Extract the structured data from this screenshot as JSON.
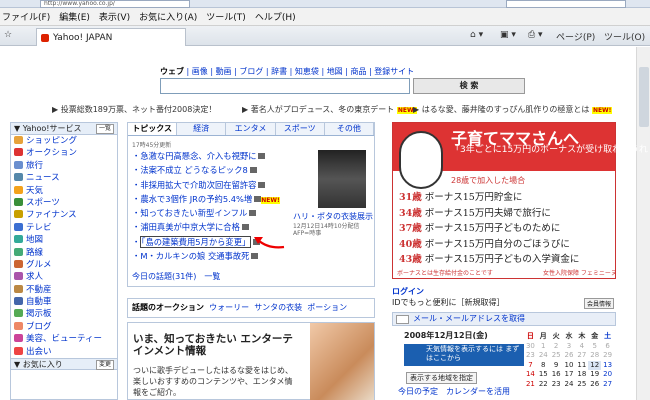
{
  "browser": {
    "url": "http://www.yahoo.co.jp/",
    "menu": [
      "ファイル(F)",
      "編集(E)",
      "表示(V)",
      "お気に入り(A)",
      "ツール(T)",
      "ヘルプ(H)"
    ],
    "tab_title": "Yahoo! JAPAN",
    "toolbar": [
      "ページ(P)",
      "ツール(O)"
    ]
  },
  "search": {
    "tabs": [
      "ウェブ",
      "画像",
      "動画",
      "ブログ",
      "辞書",
      "知恵袋",
      "地図",
      "商品",
      "登録サイト"
    ],
    "button": "検 索",
    "value": ""
  },
  "notices": [
    "投票総数189万票、ネット番付2008決定！",
    "著名人がプロデュース、冬の東京デート",
    "はるな愛、藤井隆のすっぴん肌作りの極意とは"
  ],
  "new_badge": "NEW!",
  "sidebar": {
    "header": "Yahoo!サービス",
    "header_button": "一覧",
    "items": [
      {
        "label": "ショッピング",
        "color": "#e7a23a"
      },
      {
        "label": "オークション",
        "color": "#d33"
      },
      {
        "label": "旅行",
        "color": "#6a8fcf"
      },
      {
        "label": "ニュース",
        "color": "#58a"
      },
      {
        "label": "天気",
        "color": "#f3a21c"
      },
      {
        "label": "スポーツ",
        "color": "#3a8f3a"
      },
      {
        "label": "ファイナンス",
        "color": "#c8a000"
      },
      {
        "label": "テレビ",
        "color": "#3b6fd2"
      },
      {
        "label": "地図",
        "color": "#3a9"
      },
      {
        "label": "路線",
        "color": "#4a7"
      },
      {
        "label": "グルメ",
        "color": "#c63"
      },
      {
        "label": "求人",
        "color": "#a5a"
      },
      {
        "label": "不動産",
        "color": "#b84"
      },
      {
        "label": "自動車",
        "color": "#46a"
      },
      {
        "label": "掲示板",
        "color": "#5a5"
      },
      {
        "label": "ブログ",
        "color": "#e86"
      },
      {
        "label": "美容、ビューティー",
        "color": "#c49"
      },
      {
        "label": "出会い",
        "color": "#e44"
      }
    ],
    "fav_header": "お気に入り",
    "fav_button": "変更"
  },
  "news": {
    "tabs": [
      "トピックス",
      "経済",
      "エンタメ",
      "スポーツ",
      "その他"
    ],
    "time": "17時45分更新",
    "items": [
      "急激な円高懸念、介入も視野に",
      "法案不成立 どうなるピック8",
      "非採用拡大で介助次回在留許容",
      "農水で3個作 JRの予約5.4%増",
      "知っておきたい新型インフル",
      "浦田真美が中京大学に合格",
      "「島の建築費用5月から変更」",
      "M・カルキンの娘 交通事故死"
    ],
    "photo_caption": "ハリ・ポタの衣装展示",
    "photo_credit": "12月12日14時10分配信 AFP=時事",
    "footer": "今日の話題(31件)　一覧"
  },
  "auction": {
    "label": "話題のオークション",
    "links": [
      "ウォーリー",
      "サンタの衣装",
      "ポーション"
    ]
  },
  "entertainment": {
    "title": "いま、知っておきたい エンターテインメント情報",
    "body": "ついに歌手デビューしたはるな愛をはじめ、楽しいおすすめのコンテンツや、エンタメ情報をご紹介。"
  },
  "ad": {
    "title": "子育てママさんへ",
    "subtitle": "「3年ごとに15万円のボーナスが受け取れてうれしい。」",
    "lead": "28歳で加入した場合",
    "rows": [
      {
        "age": "31歳",
        "text": "ボーナス15万円貯金に"
      },
      {
        "age": "34歳",
        "text": "ボーナス15万円夫婦で旅行に"
      },
      {
        "age": "37歳",
        "text": "ボーナス15万円子どものために"
      },
      {
        "age": "40歳",
        "text": "ボーナス15万円自分のごほうびに"
      },
      {
        "age": "43歳",
        "text": "ボーナス15万円子どもの入学資金に"
      }
    ],
    "footer": "ボーナスとは生存給付金のことです",
    "footer2": "女性入院保障 フェミニーヌ"
  },
  "login": {
    "title": "ログイン",
    "text": "IDでもっと便利に［新規取得］",
    "button": "会員情報"
  },
  "mail": {
    "label": "メール・メールアドレスを取得"
  },
  "calendar": {
    "date": "2008年12月12日(金)",
    "weather": "天気情報を表示するには まずはここから",
    "weather_button": "表示する地域を指定",
    "today": "今日の予定　カレンダーを活用",
    "weekdays": [
      "日",
      "月",
      "火",
      "水",
      "木",
      "金",
      "土"
    ],
    "rows": [
      [
        "30",
        "1",
        "2",
        "3",
        "4",
        "5",
        "6"
      ],
      [
        "23",
        "24",
        "25",
        "26",
        "27",
        "28",
        "29"
      ],
      [
        "7",
        "8",
        "9",
        "10",
        "11",
        "12",
        "13"
      ],
      [
        "14",
        "15",
        "16",
        "17",
        "18",
        "19",
        "20"
      ],
      [
        "21",
        "22",
        "23",
        "24",
        "25",
        "26",
        "27"
      ]
    ]
  }
}
